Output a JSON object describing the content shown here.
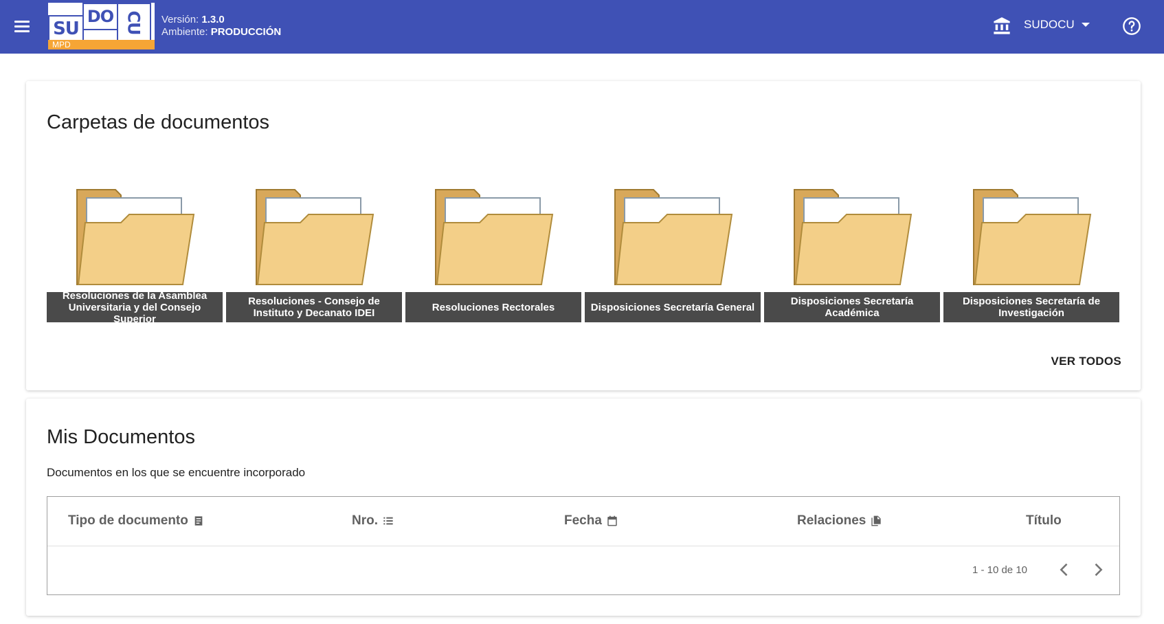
{
  "header": {
    "logo": {
      "t1": "SU",
      "t2": "DO",
      "t3": "CU",
      "sub": "MPD"
    },
    "version_label": "Versión:",
    "version_value": "1.3.0",
    "env_label": "Ambiente:",
    "env_value": "PRODUCCIÓN",
    "org_name": "SUDOCU",
    "icons": [
      "menu-icon",
      "bank-icon",
      "dropdown-caret-icon",
      "help-icon"
    ],
    "color": "#3f51b5",
    "logo_accent": "#f6a535"
  },
  "folders_card": {
    "title": "Carpetas de documentos",
    "folders": [
      {
        "label": "Resoluciones de la Asamblea Universitaria y del Consejo Superior"
      },
      {
        "label": "Resoluciones - Consejo de Instituto y Decanato IDEI"
      },
      {
        "label": "Resoluciones Rectorales"
      },
      {
        "label": "Disposiciones Secretaría General"
      },
      {
        "label": "Disposiciones Secretaría Académica"
      },
      {
        "label": "Disposiciones Secretaría de Investigación"
      }
    ],
    "view_all": "VER TODOS"
  },
  "docs_card": {
    "title": "Mis Documentos",
    "subtitle": "Documentos en los que se encuentre incorporado",
    "columns": [
      {
        "label": "Tipo de documento",
        "icon": "document-icon"
      },
      {
        "label": "Nro.",
        "icon": "list-icon"
      },
      {
        "label": "Fecha",
        "icon": "calendar-icon"
      },
      {
        "label": "Relaciones",
        "icon": "files-icon"
      },
      {
        "label": "Título",
        "icon": ""
      }
    ],
    "pagination": "1 - 10 de 10"
  }
}
